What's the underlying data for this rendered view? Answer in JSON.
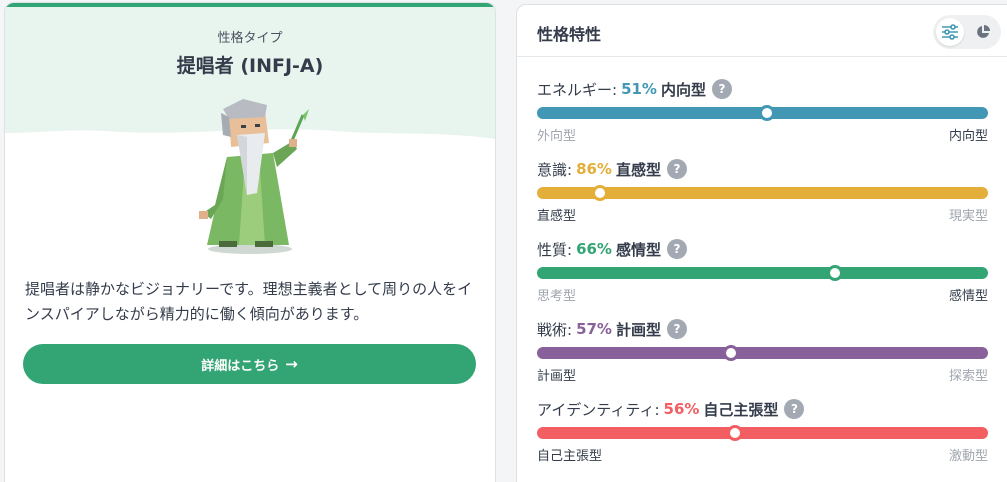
{
  "profile": {
    "caption": "性格タイプ",
    "title": "提唱者 (INFJ-A)",
    "description": "提唱者は静かなビジョナリーです。理想主義者として周りの人をインスパイアしながら精力的に働く傾向があります。",
    "cta_label": "詳細はこちら",
    "cta_icon": "arrow-right-icon",
    "accent_color": "#33a474"
  },
  "traits_panel": {
    "title": "性格特性",
    "view_toggle": {
      "sliders_icon": "sliders-icon",
      "pie_icon": "pie-chart-icon",
      "active": "sliders"
    },
    "traits": [
      {
        "name": "エネルギー:",
        "percent": "51%",
        "value": 51,
        "dominant": "内向型",
        "left_pole": "外向型",
        "right_pole": "内向型",
        "dominant_side": "right",
        "color": "#4298b4"
      },
      {
        "name": "意識:",
        "percent": "86%",
        "value": 86,
        "dominant": "直感型",
        "left_pole": "直感型",
        "right_pole": "現実型",
        "dominant_side": "left",
        "color": "#e4ae3a"
      },
      {
        "name": "性質:",
        "percent": "66%",
        "value": 66,
        "dominant": "感情型",
        "left_pole": "思考型",
        "right_pole": "感情型",
        "dominant_side": "right",
        "color": "#33a474"
      },
      {
        "name": "戦術:",
        "percent": "57%",
        "value": 57,
        "dominant": "計画型",
        "left_pole": "計画型",
        "right_pole": "探索型",
        "dominant_side": "left",
        "color": "#88619a"
      },
      {
        "name": "アイデンティティ:",
        "percent": "56%",
        "value": 56,
        "dominant": "自己主張型",
        "left_pole": "自己主張型",
        "right_pole": "激動型",
        "dominant_side": "left",
        "color": "#f25e62"
      }
    ]
  }
}
